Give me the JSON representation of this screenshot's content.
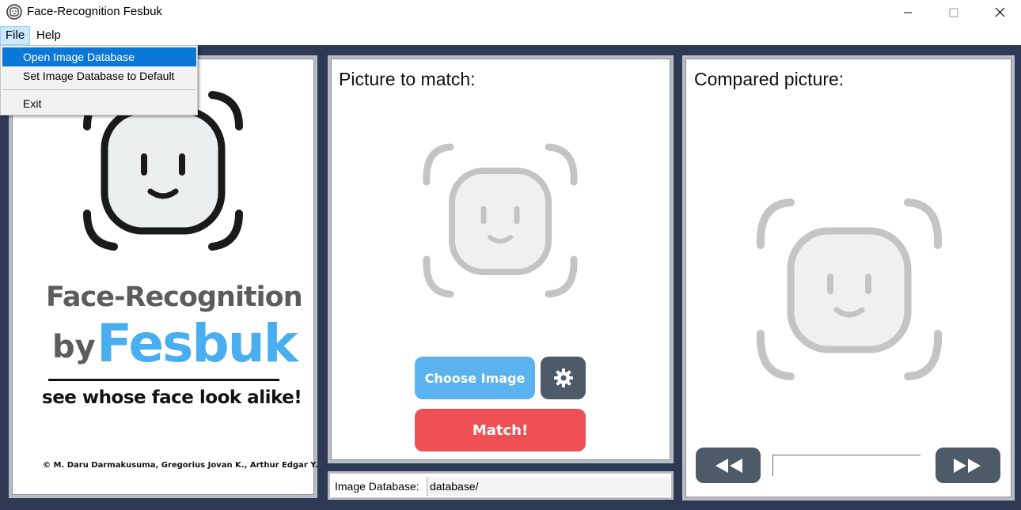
{
  "window": {
    "title": "Face-Recognition Fesbuk",
    "icon": "face-icon",
    "controls": {
      "minimize": "minimize-icon",
      "maximize": "maximize-icon",
      "close": "close-icon"
    }
  },
  "menubar": {
    "file": "File",
    "help": "Help"
  },
  "file_menu": {
    "items": [
      "Open Image Database",
      "Set Image Database to Default",
      "Exit"
    ],
    "highlighted": "Open Image Database"
  },
  "left_panel": {
    "brand_line1": "Face-Recognition",
    "brand_by": "by",
    "brand_name": "Fesbuk",
    "tagline": "see whose face look alike!",
    "credit": "© M. Daru Darmakusuma, Gregorius Jovan K., Arthur Edgar Y."
  },
  "middle_panel": {
    "title": "Picture to match:",
    "choose_button": "Choose Image",
    "settings_icon": "gear-icon",
    "match_button": "Match!"
  },
  "database_bar": {
    "label": "Image Database:",
    "value": "database/"
  },
  "right_panel": {
    "title": "Compared picture:",
    "prev_icon": "rewind-icon",
    "next_icon": "fast-forward-icon"
  },
  "colors": {
    "background": "#2e3a55",
    "choose_button": "#5ab3ee",
    "match_button": "#ee5054",
    "dark_button": "#4d5a68",
    "brand_blue": "#49aef0",
    "menu_highlight": "#0a78d7"
  }
}
